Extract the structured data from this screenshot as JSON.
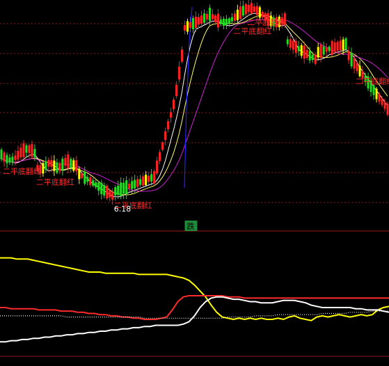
{
  "chart_data": [
    {
      "type": "candlestick",
      "panel": "price",
      "colors": {
        "up": "#ff2222",
        "down": "#22dd22",
        "doji": "#ffff00",
        "ma_fast": "#ffffff",
        "ma_mid": "#ffff66",
        "ma_slow": "#cc22cc",
        "rise": "#2222ff",
        "grid": "#8b1a1a"
      },
      "signal_labels": [
        {
          "text": "二平底翻红",
          "bar": 1
        },
        {
          "text": "二平底翻红",
          "bar": 13
        },
        {
          "text": "二平底翻红",
          "bar": 41
        },
        {
          "text": "二平底翻红",
          "bar": 84
        },
        {
          "text": "二平底翻红",
          "bar": 89
        },
        {
          "text": "二平底翻红",
          "bar": 128
        }
      ],
      "min_price_label": "6.18",
      "min_bar": 40,
      "marker": {
        "text": "跌",
        "bar": 67,
        "color": "#1f8a3a"
      }
    },
    {
      "type": "line",
      "panel": "indicator",
      "series": [
        {
          "color": "#ffff00",
          "values": [
            82,
            82,
            82,
            81,
            81,
            81,
            80,
            79,
            78,
            77,
            76,
            75,
            74,
            73,
            72,
            71,
            70,
            70,
            70,
            69,
            69,
            69,
            69,
            69,
            69,
            68,
            68,
            68,
            68,
            68,
            68,
            67,
            66,
            65,
            63,
            59,
            54,
            49,
            42,
            36,
            32,
            31,
            30,
            31,
            30,
            31,
            30,
            31,
            30,
            30,
            31,
            30,
            32,
            33,
            31,
            30,
            29,
            32,
            33,
            32,
            33,
            34,
            33,
            32,
            33,
            34,
            33,
            34,
            38,
            40,
            41
          ]
        },
        {
          "color": "#ff2a2a",
          "values": [
            40,
            40,
            39,
            39,
            39,
            39,
            39,
            38,
            38,
            38,
            38,
            37,
            37,
            37,
            36,
            36,
            35,
            35,
            34,
            34,
            33,
            33,
            32,
            32,
            31,
            31,
            30,
            30,
            30,
            31,
            32,
            38,
            45,
            49,
            50,
            50,
            50,
            50,
            50,
            50,
            50,
            49,
            49,
            49,
            48,
            48,
            48,
            48,
            48,
            48,
            48,
            48,
            48,
            48,
            48,
            48,
            48,
            48,
            48,
            48,
            48,
            48,
            48,
            48,
            48,
            48,
            48,
            48,
            48,
            48,
            48
          ]
        },
        {
          "color": "#ffffff",
          "values": [
            11,
            11,
            12,
            12,
            13,
            13,
            14,
            14,
            15,
            15,
            16,
            16,
            17,
            17,
            18,
            18,
            19,
            19,
            20,
            20,
            21,
            21,
            22,
            22,
            23,
            23,
            24,
            24,
            25,
            25,
            25,
            25,
            25,
            26,
            28,
            33,
            40,
            45,
            48,
            49,
            49,
            48,
            47,
            47,
            46,
            45,
            45,
            44,
            44,
            44,
            45,
            46,
            46,
            46,
            45,
            44,
            42,
            41,
            40,
            40,
            40,
            40,
            40,
            40,
            39,
            39,
            38,
            38,
            38,
            37,
            36
          ]
        },
        {
          "color": "#ffffff",
          "dotted": true,
          "values": [
            33,
            33,
            33,
            33,
            33,
            33,
            33,
            33,
            33,
            33,
            33,
            33,
            32,
            32,
            32,
            32,
            32,
            32,
            32,
            32,
            32,
            32,
            32,
            32,
            32,
            32,
            31,
            31,
            31,
            31,
            31,
            31,
            31,
            31,
            31,
            31,
            31,
            31,
            31,
            31,
            31,
            32,
            32,
            32,
            32,
            32,
            33,
            33,
            33,
            33,
            34,
            34,
            34,
            34,
            34,
            34,
            34,
            34,
            35,
            35,
            35,
            35,
            35,
            36,
            36,
            36,
            36,
            37,
            37,
            37,
            37
          ]
        }
      ]
    }
  ]
}
